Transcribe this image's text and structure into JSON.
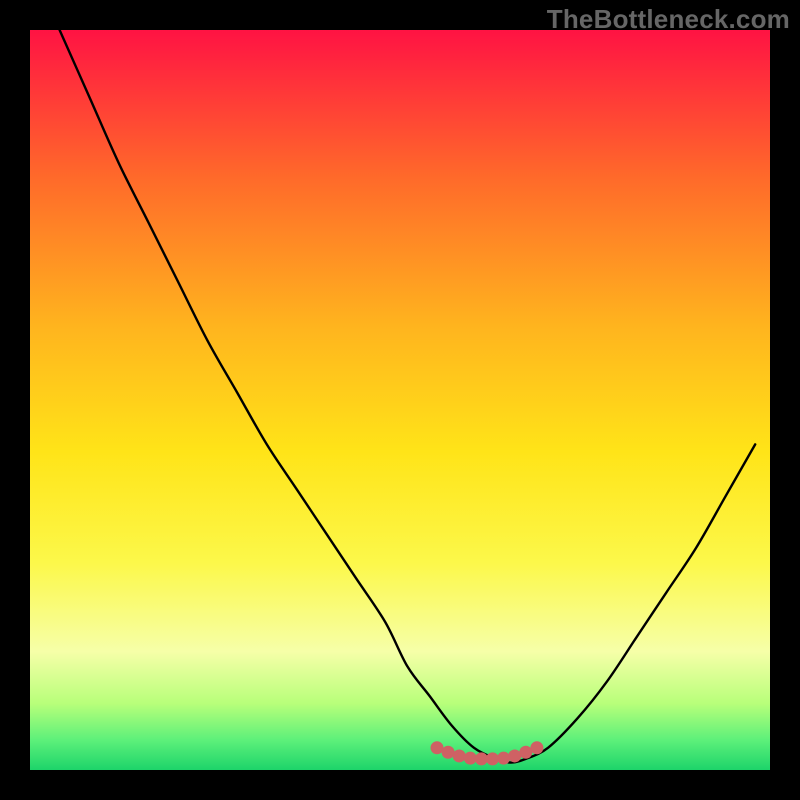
{
  "watermark": "TheBottleneck.com",
  "colors": {
    "gradient": [
      "#ff1343",
      "#ff6a2a",
      "#ffb41e",
      "#ffe418",
      "#fcf84a",
      "#f6ffa8",
      "#b8ff7a",
      "#5cf07a",
      "#1dd46a"
    ],
    "curve": "#000000",
    "marker": "#cf6164",
    "frame": "#000000"
  },
  "chart_data": {
    "type": "line",
    "title": "",
    "xlabel": "",
    "ylabel": "",
    "xlim": [
      0,
      100
    ],
    "ylim": [
      0,
      100
    ],
    "series": [
      {
        "name": "bottleneck-curve",
        "x": [
          4,
          8,
          12,
          16,
          20,
          24,
          28,
          32,
          36,
          40,
          44,
          48,
          51,
          54,
          57,
          60,
          63,
          65,
          67,
          70,
          74,
          78,
          82,
          86,
          90,
          94,
          98
        ],
        "values": [
          100,
          91,
          82,
          74,
          66,
          58,
          51,
          44,
          38,
          32,
          26,
          20,
          14,
          10,
          6,
          3,
          1.5,
          1,
          1.5,
          3,
          7,
          12,
          18,
          24,
          30,
          37,
          44
        ]
      },
      {
        "name": "optimal-zone-markers",
        "x": [
          55,
          56.5,
          58,
          59.5,
          61,
          62.5,
          64,
          65.5,
          67,
          68.5
        ],
        "values": [
          3.0,
          2.4,
          1.9,
          1.6,
          1.5,
          1.5,
          1.6,
          1.9,
          2.4,
          3.0
        ]
      }
    ]
  }
}
